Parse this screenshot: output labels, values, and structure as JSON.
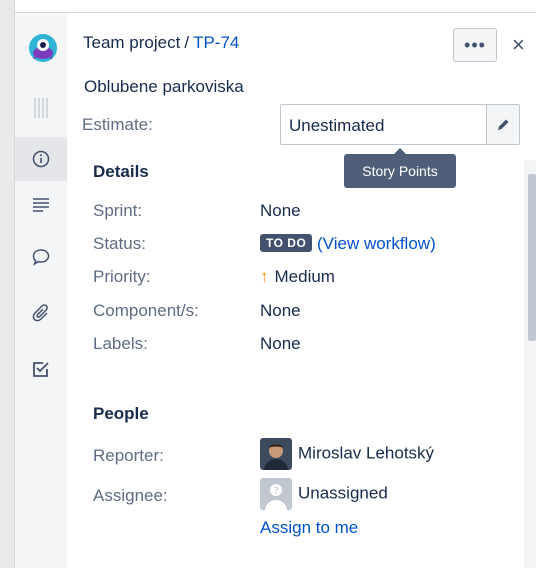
{
  "breadcrumb": {
    "project": "Team project",
    "separator": "/",
    "issue_key": "TP-74"
  },
  "header": {
    "more_label": "•••",
    "close_label": "×"
  },
  "summary": "Oblubene parkoviska",
  "estimate": {
    "label": "Estimate:",
    "value": "Unestimated",
    "tooltip": "Story Points"
  },
  "details": {
    "title": "Details",
    "sprint_label": "Sprint:",
    "sprint_value": "None",
    "status_label": "Status:",
    "status_value": "TO DO",
    "status_link": "(View workflow)",
    "priority_label": "Priority:",
    "priority_value": "Medium",
    "components_label": "Component/s:",
    "components_value": "None",
    "labels_label": "Labels:",
    "labels_value": "None"
  },
  "people": {
    "title": "People",
    "reporter_label": "Reporter:",
    "reporter_value": "Miroslav Lehotský",
    "assignee_label": "Assignee:",
    "assignee_value": "Unassigned",
    "assign_to_me": "Assign to me"
  },
  "icons": [
    "app-logo-icon",
    "drag-handle-icon",
    "info-icon",
    "description-icon",
    "comment-icon",
    "attachment-icon",
    "checklist-icon",
    "pencil-icon",
    "arrow-up-icon"
  ],
  "colors": {
    "accent": "#0052cc",
    "lozenge": "#42526e",
    "priority_medium": "#ff8b00",
    "tooltip": "#505f79"
  }
}
